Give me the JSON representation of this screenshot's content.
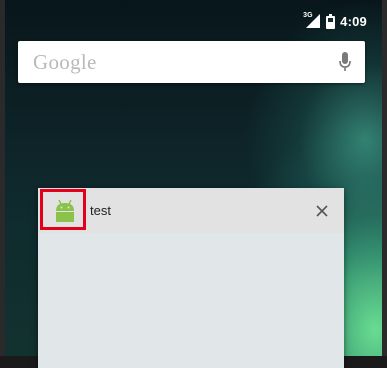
{
  "status_bar": {
    "network_type": "3G",
    "time": "4:09",
    "icons": [
      "signal-icon",
      "battery-icon"
    ]
  },
  "search_bar": {
    "logo_text": "Google",
    "mic_icon": "mic-icon"
  },
  "recent_task": {
    "app_title": "test",
    "app_icon": "android-icon",
    "close_icon": "close-icon",
    "highlight_color": "#e3001b"
  },
  "colors": {
    "wallpaper_dark": "#0d2226",
    "wallpaper_glow": "#6ee696",
    "card_header": "#e2e2e2",
    "card_body": "#e1e6e8",
    "android_green": "#8bc34a"
  }
}
